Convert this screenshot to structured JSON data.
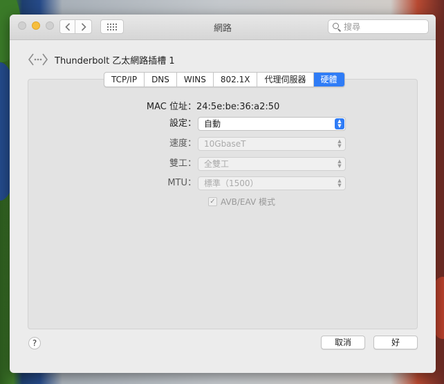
{
  "window": {
    "title": "網路"
  },
  "search": {
    "placeholder": "搜尋"
  },
  "header": {
    "port_name": "Thunderbolt 乙太網路插槽 1"
  },
  "tabs": [
    {
      "label": "TCP/IP"
    },
    {
      "label": "DNS"
    },
    {
      "label": "WINS"
    },
    {
      "label": "802.1X"
    },
    {
      "label": "代理伺服器"
    },
    {
      "label": "硬體",
      "active": true
    }
  ],
  "hardware": {
    "mac_label": "MAC 位址：",
    "mac_value": "24:5e:be:36:a2:50",
    "config_label": "設定：",
    "config_value": "自動",
    "speed_label": "速度：",
    "speed_value": "10GbaseT",
    "duplex_label": "雙工：",
    "duplex_value": "全雙工",
    "mtu_label": "MTU：",
    "mtu_value": "標準（1500）",
    "avb_label": "AVB/EAV 模式",
    "avb_checked": true
  },
  "footer": {
    "help_label": "?",
    "cancel_label": "取消",
    "ok_label": "好"
  },
  "colors": {
    "accent": "#2f7cf6",
    "window_bg": "#ececec",
    "panel_bg": "#e3e3e3"
  }
}
